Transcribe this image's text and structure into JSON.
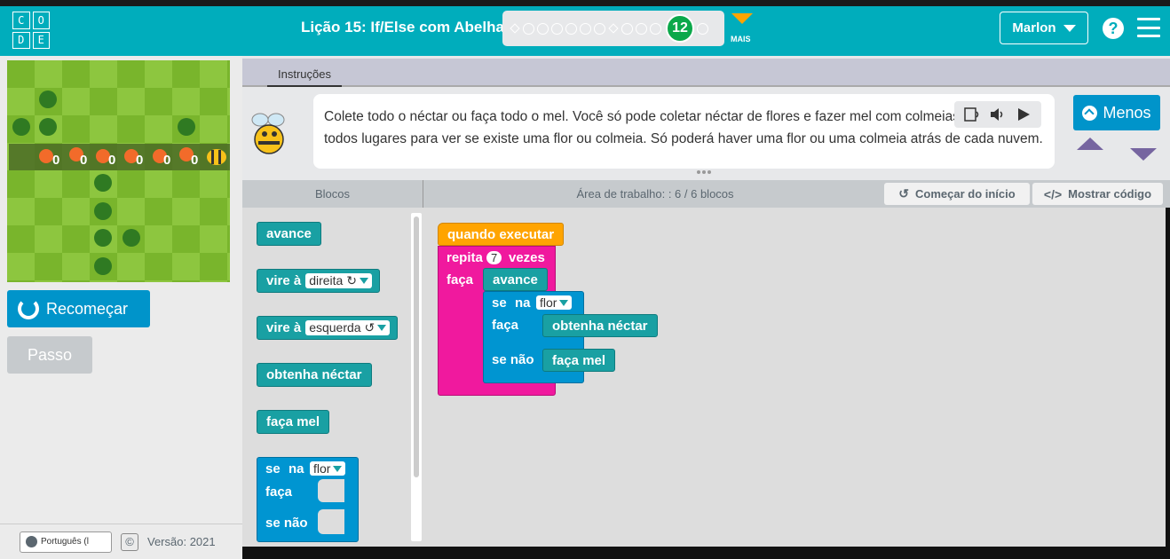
{
  "header": {
    "logo_letters": [
      "C",
      "O",
      "D",
      "E"
    ],
    "lesson_title": "Lição 15: If/Else com Abelha",
    "current_level": "12",
    "more_label": "MAIS",
    "user_name": "Marlon",
    "help_glyph": "?"
  },
  "game": {
    "nectar_counts": [
      "0",
      "0",
      "0",
      "0",
      "0",
      "0"
    ]
  },
  "left": {
    "reset_label": "Recomeçar",
    "step_label": "Passo",
    "language": "Português (l",
    "copyright_glyph": "©",
    "version": "Versão: 2021"
  },
  "instructions": {
    "tab_label": "Instruções",
    "text": "Colete todo o néctar ou faça todo o mel. Você só pode coletar néctar de flores e fazer mel com colmeias. Verifique todos lugares para ver se existe uma flor ou colmeia. Só poderá haver uma flor ou uma colmeia atrás de cada nuvem.",
    "less_label": "Menos"
  },
  "code_header": {
    "toolbox_title": "Blocos",
    "workspace_title": "Área de trabalho: : 6 / 6 blocos",
    "start_over_label": "Começar do início",
    "show_code_label": "Mostrar código",
    "start_over_icon": "↺",
    "show_code_icon": "</>"
  },
  "toolbox": {
    "move_forward": "avance",
    "turn_label": "vire à",
    "turn_right_option": "direita ↻",
    "turn_left_option": "esquerda ↺",
    "get_nectar": "obtenha néctar",
    "make_honey": "faça mel",
    "if_label": "se",
    "at_label": "na",
    "flower_option": "flor",
    "do_label": "faça",
    "else_label": "se não"
  },
  "workspace": {
    "when_run": "quando executar",
    "repeat_label": "repita",
    "repeat_count": "7",
    "times_label": "vezes",
    "do_label": "faça",
    "move_forward": "avance",
    "if_label": "se",
    "at_label": "na",
    "flower_option": "flor",
    "inner_do_label": "faça",
    "get_nectar": "obtenha néctar",
    "else_label": "se não",
    "make_honey": "faça mel"
  },
  "colors": {
    "header": "#00adbc",
    "blue_button": "#0094ca",
    "teal_block": "#19a0a3",
    "blue_block": "#0095d1",
    "orange_block": "#ffa400",
    "pink_block": "#f0199e",
    "progress_current": "#0ba84a"
  },
  "icons": [
    "code-logo",
    "caret-down-icon",
    "help-icon",
    "hamburger-menu-icon",
    "reset-icon",
    "globe-icon",
    "copyright-icon",
    "bee-avatar",
    "text-to-speech-icon",
    "speaker-icon",
    "play-icon",
    "chevron-up-icon",
    "undo-icon",
    "code-icon"
  ]
}
